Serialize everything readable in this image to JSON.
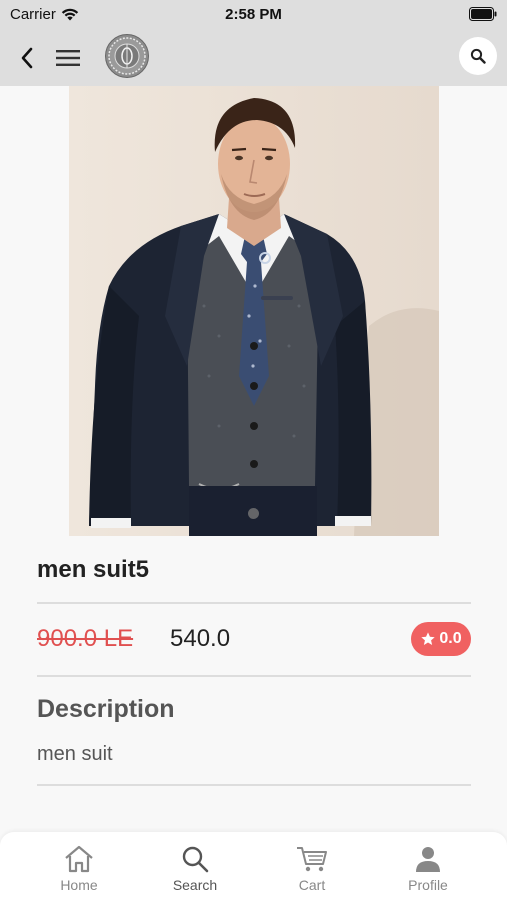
{
  "status_bar": {
    "carrier": "Carrier",
    "time": "2:58 PM"
  },
  "nav": {
    "icons": [
      "back-arrow-icon",
      "hamburger-menu-icon",
      "brand-logo",
      "search-icon"
    ]
  },
  "product": {
    "name": "men suit5",
    "old_price": "900.0 LE",
    "price": "540.0",
    "rating": "0.0",
    "description_heading": "Description",
    "description": "men suit",
    "image_count_visible": 1
  },
  "tabs": [
    {
      "label": "Home",
      "icon": "home-icon"
    },
    {
      "label": "Search",
      "icon": "search-icon",
      "active": true
    },
    {
      "label": "Cart",
      "icon": "cart-icon"
    },
    {
      "label": "Profile",
      "icon": "profile-icon"
    }
  ],
  "colors": {
    "accent": "#f06161",
    "old_price": "#e05050",
    "header_bg": "#dedede",
    "page_bg": "#f8f8f8"
  }
}
